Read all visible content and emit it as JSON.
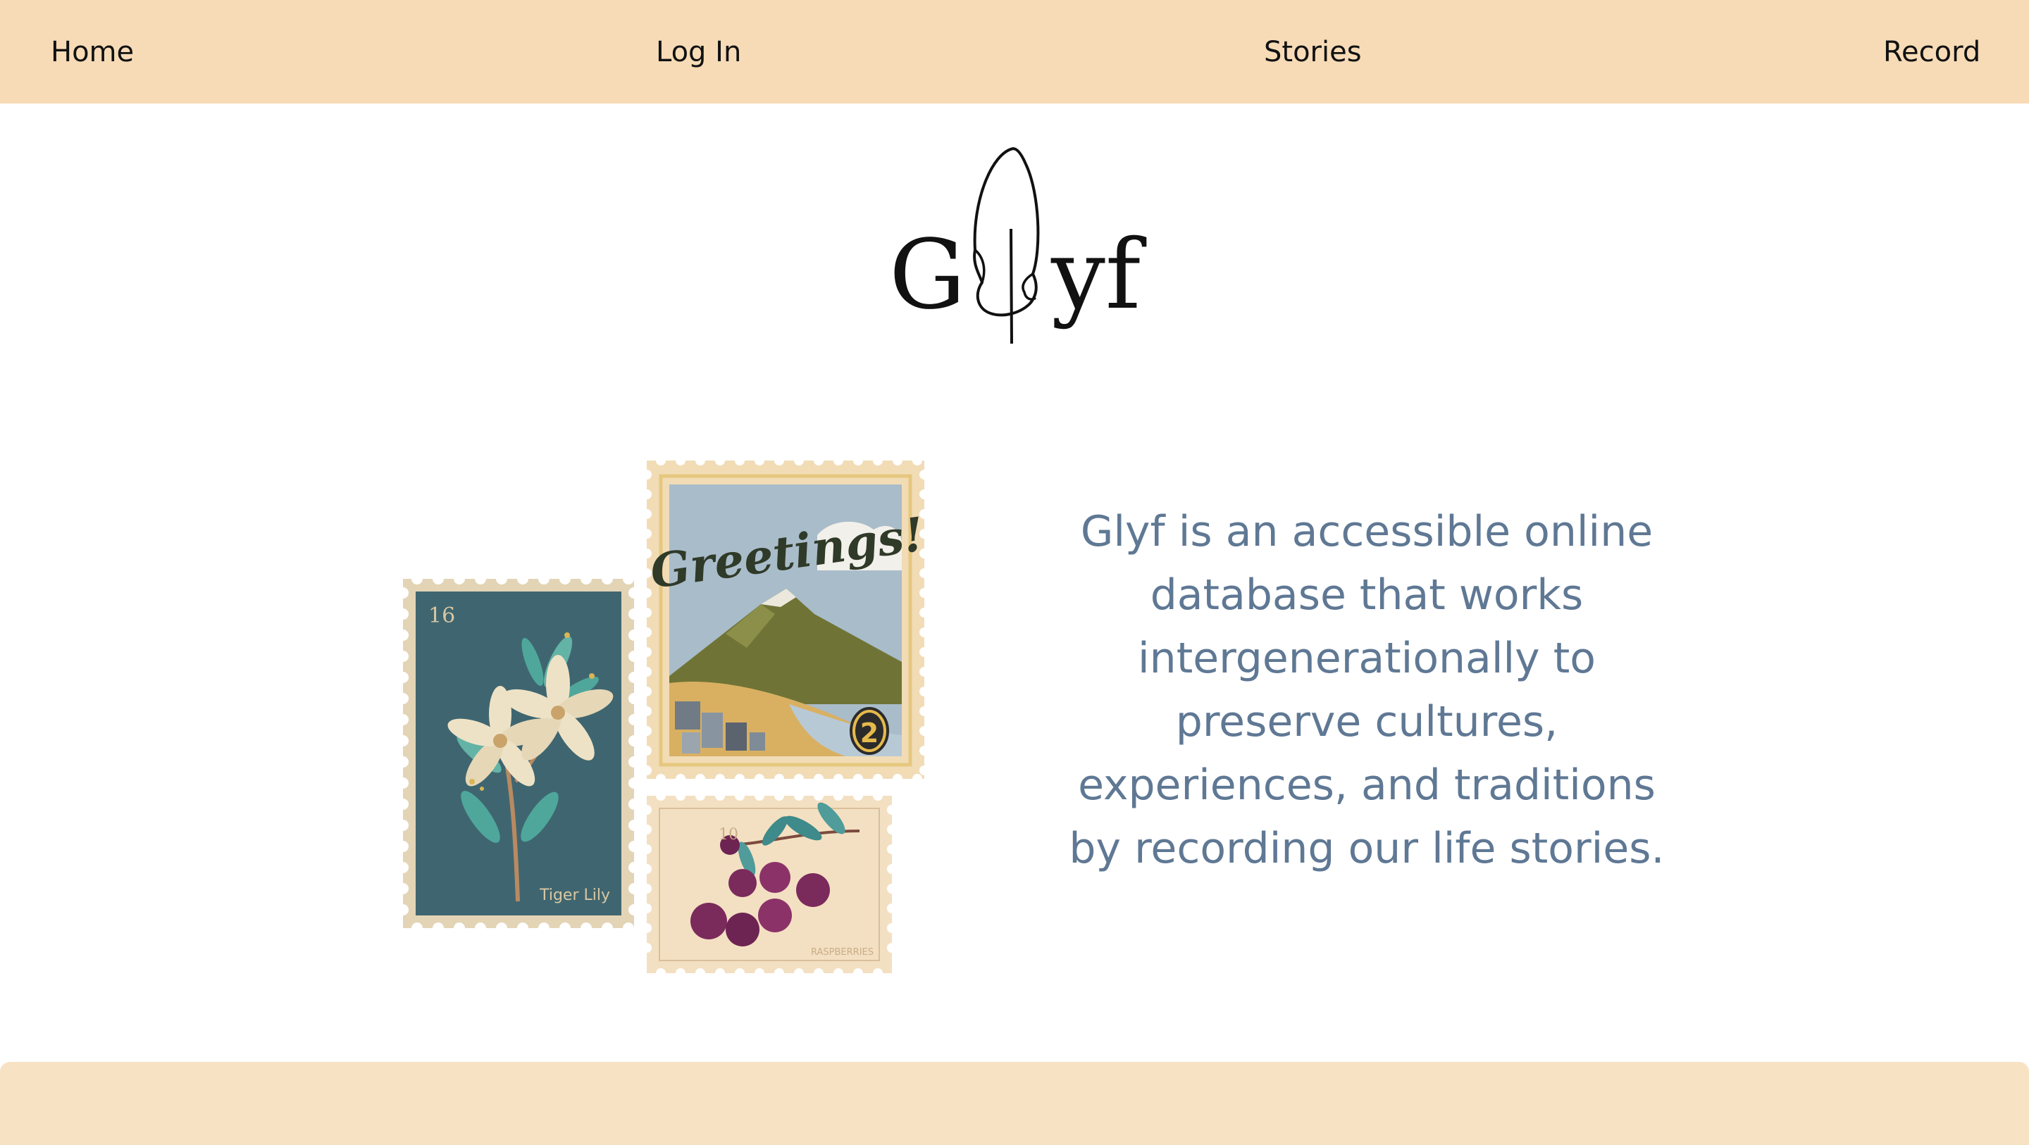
{
  "nav": {
    "home": "Home",
    "login": "Log In",
    "stories": "Stories",
    "record": "Record"
  },
  "logo": {
    "brand": "Glyf",
    "left_text": "G",
    "right_text": "yf",
    "icon": "feather-icon"
  },
  "stamps": {
    "tiger_lily": {
      "number": "16",
      "caption": "Tiger Lily",
      "icon": "lily-icon"
    },
    "greetings": {
      "title": "Greetings!",
      "number": "2",
      "icon": "mountain-icon"
    },
    "raspberries": {
      "number": "10",
      "caption": "RASPBERRIES",
      "icon": "raspberry-icon"
    }
  },
  "intro": {
    "lines": [
      "Glyf is an accessible online",
      "database that works",
      "intergenerationally to",
      "preserve cultures,",
      "experiences, and traditions",
      "by recording our life stories."
    ]
  },
  "colors": {
    "nav_bg": "#f6dbb6",
    "footer_bg": "#f8e2c4",
    "intro_text": "#5f7894"
  }
}
